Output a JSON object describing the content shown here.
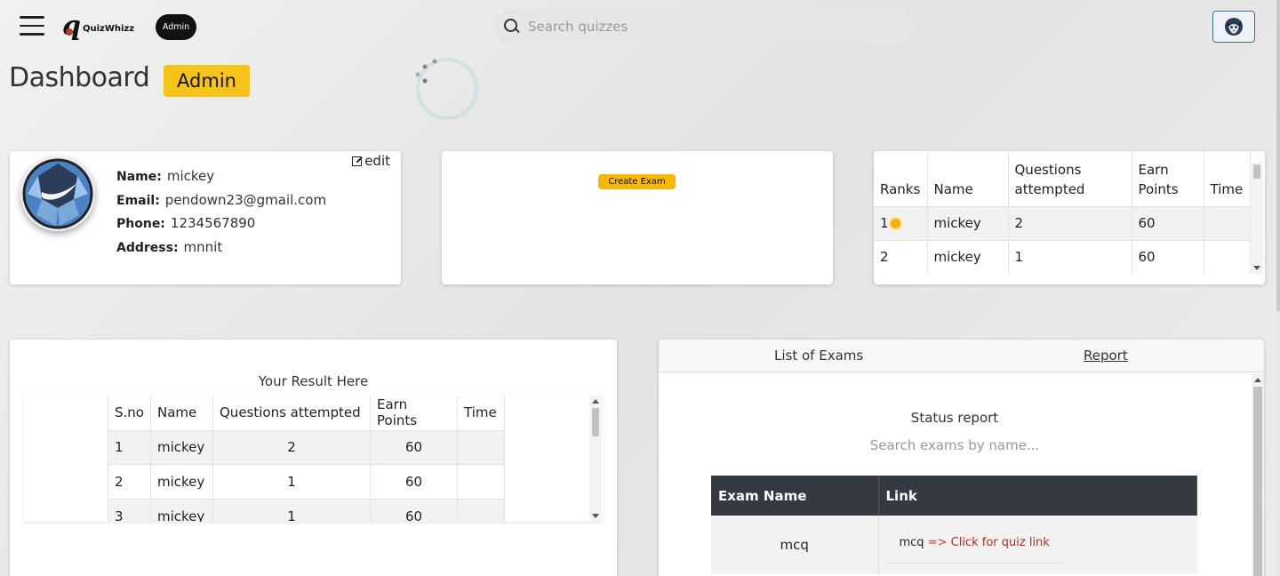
{
  "header": {
    "logo_text": "QuizWhizz",
    "logo_mark": "q",
    "role_pill": "Admin",
    "search_placeholder": "Search quizzes"
  },
  "page": {
    "title": "Dashboard",
    "role_badge": "Admin"
  },
  "profile": {
    "edit_label": "edit",
    "fields": [
      {
        "label": "Name:",
        "value": "mickey"
      },
      {
        "label": "Email:",
        "value": "pendown23@gmail.com"
      },
      {
        "label": "Phone:",
        "value": "1234567890"
      },
      {
        "label": "Address:",
        "value": "mnnit"
      }
    ]
  },
  "create_exam": {
    "button_label": "Create Exam"
  },
  "ranks": {
    "columns": [
      "Ranks",
      "Name",
      "Questions attempted",
      "Earn Points",
      "Time"
    ],
    "rows": [
      {
        "rank": "1",
        "name": "mickey",
        "questions": "2",
        "points": "60",
        "time": ""
      },
      {
        "rank": "2",
        "name": "mickey",
        "questions": "1",
        "points": "60",
        "time": ""
      }
    ]
  },
  "results": {
    "title": "Your Result Here",
    "columns": [
      "S.no",
      "Name",
      "Questions attempted",
      "Earn Points",
      "Time"
    ],
    "rows": [
      {
        "sno": "1",
        "name": "mickey",
        "questions": "2",
        "points": "60",
        "time": ""
      },
      {
        "sno": "2",
        "name": "mickey",
        "questions": "1",
        "points": "60",
        "time": ""
      },
      {
        "sno": "3",
        "name": "mickey",
        "questions": "1",
        "points": "60",
        "time": ""
      }
    ]
  },
  "exams": {
    "tabs": [
      "List of Exams",
      "Report"
    ],
    "status_title": "Status report",
    "search_placeholder": "Search exams by name...",
    "columns": [
      "Exam Name",
      "Link"
    ],
    "rows": [
      {
        "name": "mcq",
        "prefix": "mcq",
        "arrow": "=>",
        "link_text": "Click for quiz link"
      }
    ]
  },
  "colors": {
    "accent_yellow": "#f6c319",
    "table_header_dark": "#343a40",
    "link_red": "#b62b1c"
  }
}
